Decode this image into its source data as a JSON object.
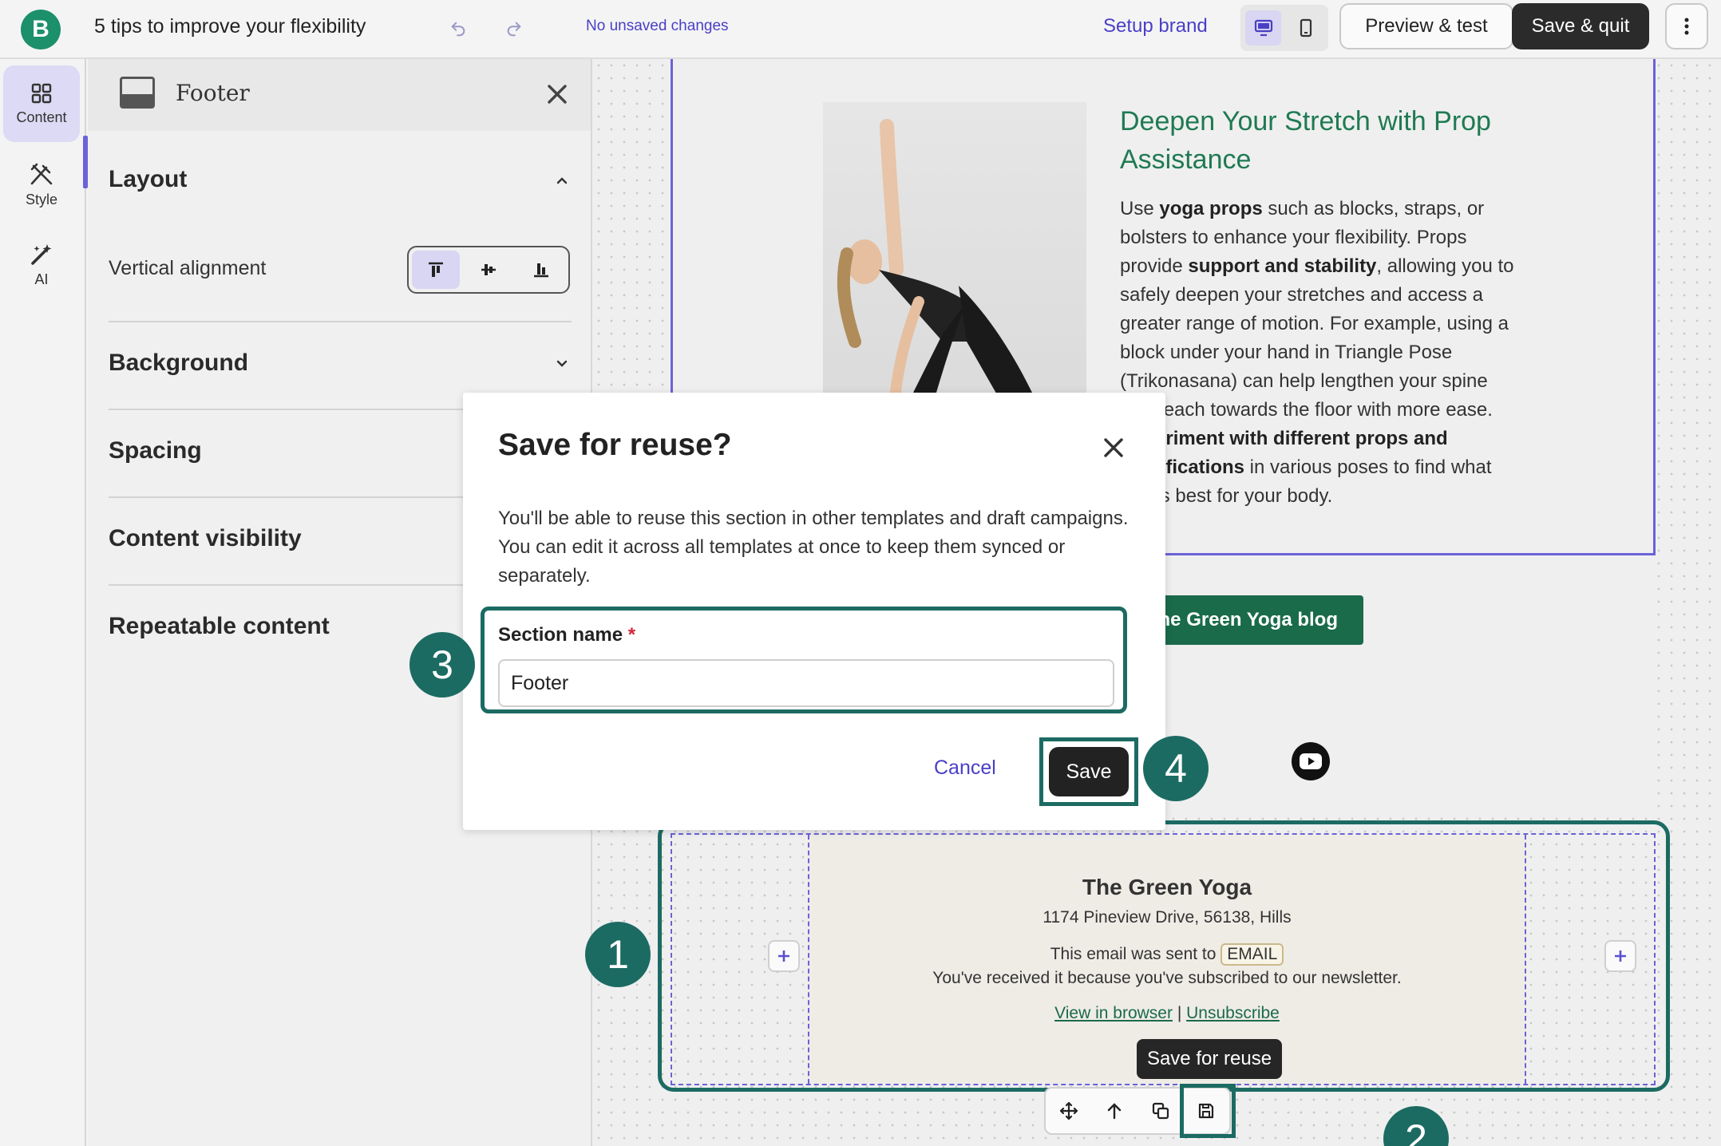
{
  "app": {
    "logo_letter": "B",
    "doc_title": "5 tips to improve your flexibility",
    "save_status": "No unsaved changes"
  },
  "topbar": {
    "setup_brand": "Setup brand",
    "preview": "Preview & test",
    "save_quit": "Save & quit"
  },
  "rail": [
    {
      "label": "Content",
      "icon": "grid-icon"
    },
    {
      "label": "Style",
      "icon": "brush-icon"
    },
    {
      "label": "AI",
      "icon": "magic-wand-icon"
    }
  ],
  "panel": {
    "title": "Footer",
    "sections": {
      "layout": "Layout",
      "background": "Background",
      "spacing": "Spacing",
      "visibility": "Content visibility",
      "repeatable": "Repeatable content"
    },
    "valign_label": "Vertical alignment"
  },
  "article": {
    "heading": "Deepen Your Stretch with Prop Assistance",
    "body": "Use yoga props such as blocks, straps, or bolsters to enhance your flexibility. Props provide support and stability, allowing you to safely deepen your stretches and access a greater range of motion. For example, using a block under your hand in Triangle Pose (Trikonasana) can help lengthen your spine and reach towards the floor with more ease. Experiment with different props and modifications in various poses to find what works best for your body.",
    "button": "Read more on The Green Yoga blog",
    "button_visible": "he Green Yoga blog"
  },
  "footer": {
    "company": "The Green Yoga",
    "address": "1174 Pineview Drive, 56138, Hills",
    "sent_prefix": "This email was sent to",
    "email_tag": "EMAIL",
    "reason": "You've received it because you've subscribed to our newsletter.",
    "view_link": "View in browser",
    "separator": "|",
    "unsubscribe": "Unsubscribe"
  },
  "tooltip": "Save for reuse",
  "modal": {
    "title": "Save for reuse?",
    "description": "You'll be able to reuse this section in other templates and draft campaigns. You can edit it across all templates at once to keep them synced or separately.",
    "field_label": "Section name",
    "required_mark": "*",
    "field_value": "Footer",
    "cancel": "Cancel",
    "save": "Save"
  },
  "steps": [
    "1",
    "2",
    "3",
    "4"
  ],
  "colors": {
    "brand": "#1c8f6b",
    "accent": "#4a3fc6",
    "highlight": "#1c6b63",
    "article_green": "#1f7a53"
  }
}
